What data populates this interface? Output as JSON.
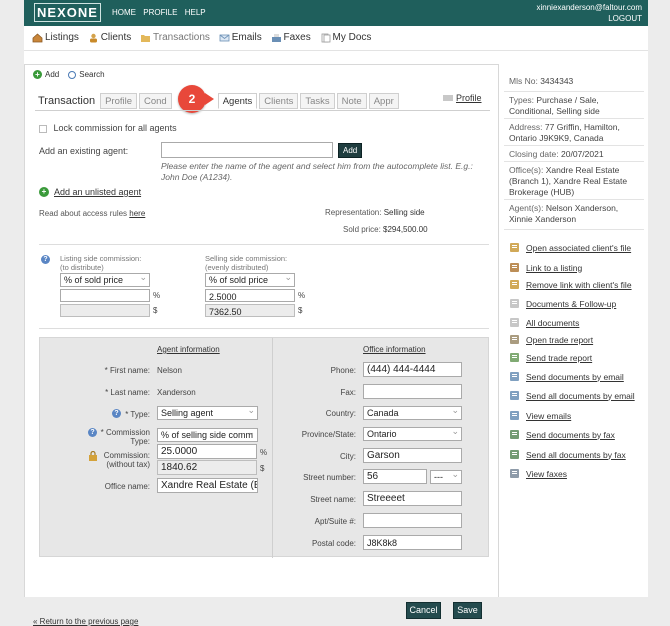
{
  "header": {
    "logo": "NEXONE",
    "nav": [
      "HOME",
      "PROFILE",
      "HELP"
    ],
    "email": "xinniexanderson@faltour.com",
    "logout": "LOGOUT"
  },
  "main_nav": [
    {
      "label": "Listings",
      "icon": "house-icon"
    },
    {
      "label": "Clients",
      "icon": "clients-icon"
    },
    {
      "label": "Transactions",
      "icon": "folder-icon"
    },
    {
      "label": "Emails",
      "icon": "envelope-icon"
    },
    {
      "label": "Faxes",
      "icon": "fax-icon"
    },
    {
      "label": "My Docs",
      "icon": "docs-icon"
    }
  ],
  "toolbar": {
    "add": "Add",
    "search": "Search"
  },
  "tabs": {
    "title": "Transaction",
    "items": [
      "Profile",
      "Cond",
      "Agents",
      "Clients",
      "Tasks",
      "Note",
      "Appr"
    ],
    "active": "Agents",
    "profile_link": "Profile",
    "step_badge": "2"
  },
  "form": {
    "lock_commission": "Lock commission for all agents",
    "add_existing_label": "Add an existing agent:",
    "add_button": "Add",
    "help_text": "Please enter the name of the agent and select him from the autocomplete list. E.g.: John Doe (A1234).",
    "add_unlisted": "Add an unlisted agent",
    "access_rules_prefix": "Read about access rules ",
    "access_rules_link": "here",
    "representation_label": "Representation:",
    "representation_value": "Selling side",
    "sold_price_label": "Sold price:",
    "sold_price_value": "$294,500.00"
  },
  "commission": {
    "listing_label": "Listing side commission:",
    "listing_sub": "(to distribute)",
    "listing_select": "% of sold price",
    "listing_percent": "",
    "listing_amount": "",
    "selling_label": "Selling side commission:",
    "selling_sub": "(evenly distributed)",
    "selling_select": "% of sold price",
    "selling_percent": "2.5000",
    "selling_amount": "7362.50",
    "pct": "%",
    "dollar": "$"
  },
  "agent_info": {
    "header": "Agent information",
    "first_name_label": "* First name:",
    "first_name": "Nelson",
    "last_name_label": "* Last name:",
    "last_name": "Xanderson",
    "type_label": "* Type:",
    "type": "Selling agent",
    "commission_type_label": "* Commission Type:",
    "commission_type": "% of selling side comm",
    "commission_label": "Commission:",
    "commission_sub": "(without tax)",
    "commission_percent": "25.0000",
    "commission_amount": "1840.62",
    "office_name_label": "Office name:",
    "office_name": "Xandre Real Estate (Bra"
  },
  "office_info": {
    "header": "Office information",
    "phone_label": "Phone:",
    "phone": "(444) 444-4444",
    "fax_label": "Fax:",
    "fax": "",
    "country_label": "Country:",
    "country": "Canada",
    "province_label": "Province/State:",
    "province": "Ontario",
    "city_label": "City:",
    "city": "Garson",
    "street_number_label": "Street number:",
    "street_number": "56",
    "street_suffix": "---",
    "street_name_label": "Street name:",
    "street_name": "Streeeet",
    "apt_label": "Apt/Suite #:",
    "apt": "",
    "postal_label": "Postal code:",
    "postal": "J8K8k8"
  },
  "buttons": {
    "cancel": "Cancel",
    "save": "Save"
  },
  "return_link": "« Return to the previous page",
  "sidebar": {
    "mls_label": "Mls No:",
    "mls": "3434343",
    "types_label": "Types:",
    "types": "Purchase / Sale, Conditional, Selling side",
    "address_label": "Address:",
    "address": "77 Griffin, Hamilton, Ontario J9K9K9, Canada",
    "closing_label": "Closing date:",
    "closing": "20/07/2021",
    "offices_label": "Office(s):",
    "offices": "Xandre Real Estate (Branch 1), Xandre Real Estate Brokerage (HUB)",
    "agents_label": "Agent(s):",
    "agents": "Nelson Xanderson, Xinnie Xanderson",
    "actions": [
      {
        "label": "Open associated client's file",
        "icon": "client-file-icon",
        "color": "#c99a3b"
      },
      {
        "label": "Link to a listing",
        "icon": "house-link-icon",
        "color": "#b07a3a"
      },
      {
        "label": "Remove link with client's file",
        "icon": "unlink-client-icon",
        "color": "#c99a3b"
      },
      {
        "label": "Documents",
        "label2": "Follow-up",
        "icon": "documents-icon",
        "color": "#bdbdbd"
      },
      {
        "label": "All documents",
        "icon": "all-documents-icon",
        "color": "#bdbdbd"
      },
      {
        "label": "Open trade report",
        "icon": "open-report-icon",
        "color": "#9b8b6a"
      },
      {
        "label": "Send trade report",
        "icon": "send-report-icon",
        "color": "#6a9b5a"
      },
      {
        "label": "Send documents by email",
        "icon": "email-docs-icon",
        "color": "#6a8fb5"
      },
      {
        "label": "Send all documents by email",
        "icon": "email-all-icon",
        "color": "#6a8fb5"
      },
      {
        "label": "View emails",
        "icon": "view-emails-icon",
        "color": "#6a8fb5"
      },
      {
        "label": "Send documents by fax",
        "icon": "fax-docs-icon",
        "color": "#5a8a5a"
      },
      {
        "label": "Send all documents by fax",
        "icon": "fax-all-icon",
        "color": "#5a8a5a"
      },
      {
        "label": "View faxes",
        "icon": "view-faxes-icon",
        "color": "#7a8a9a"
      }
    ]
  }
}
